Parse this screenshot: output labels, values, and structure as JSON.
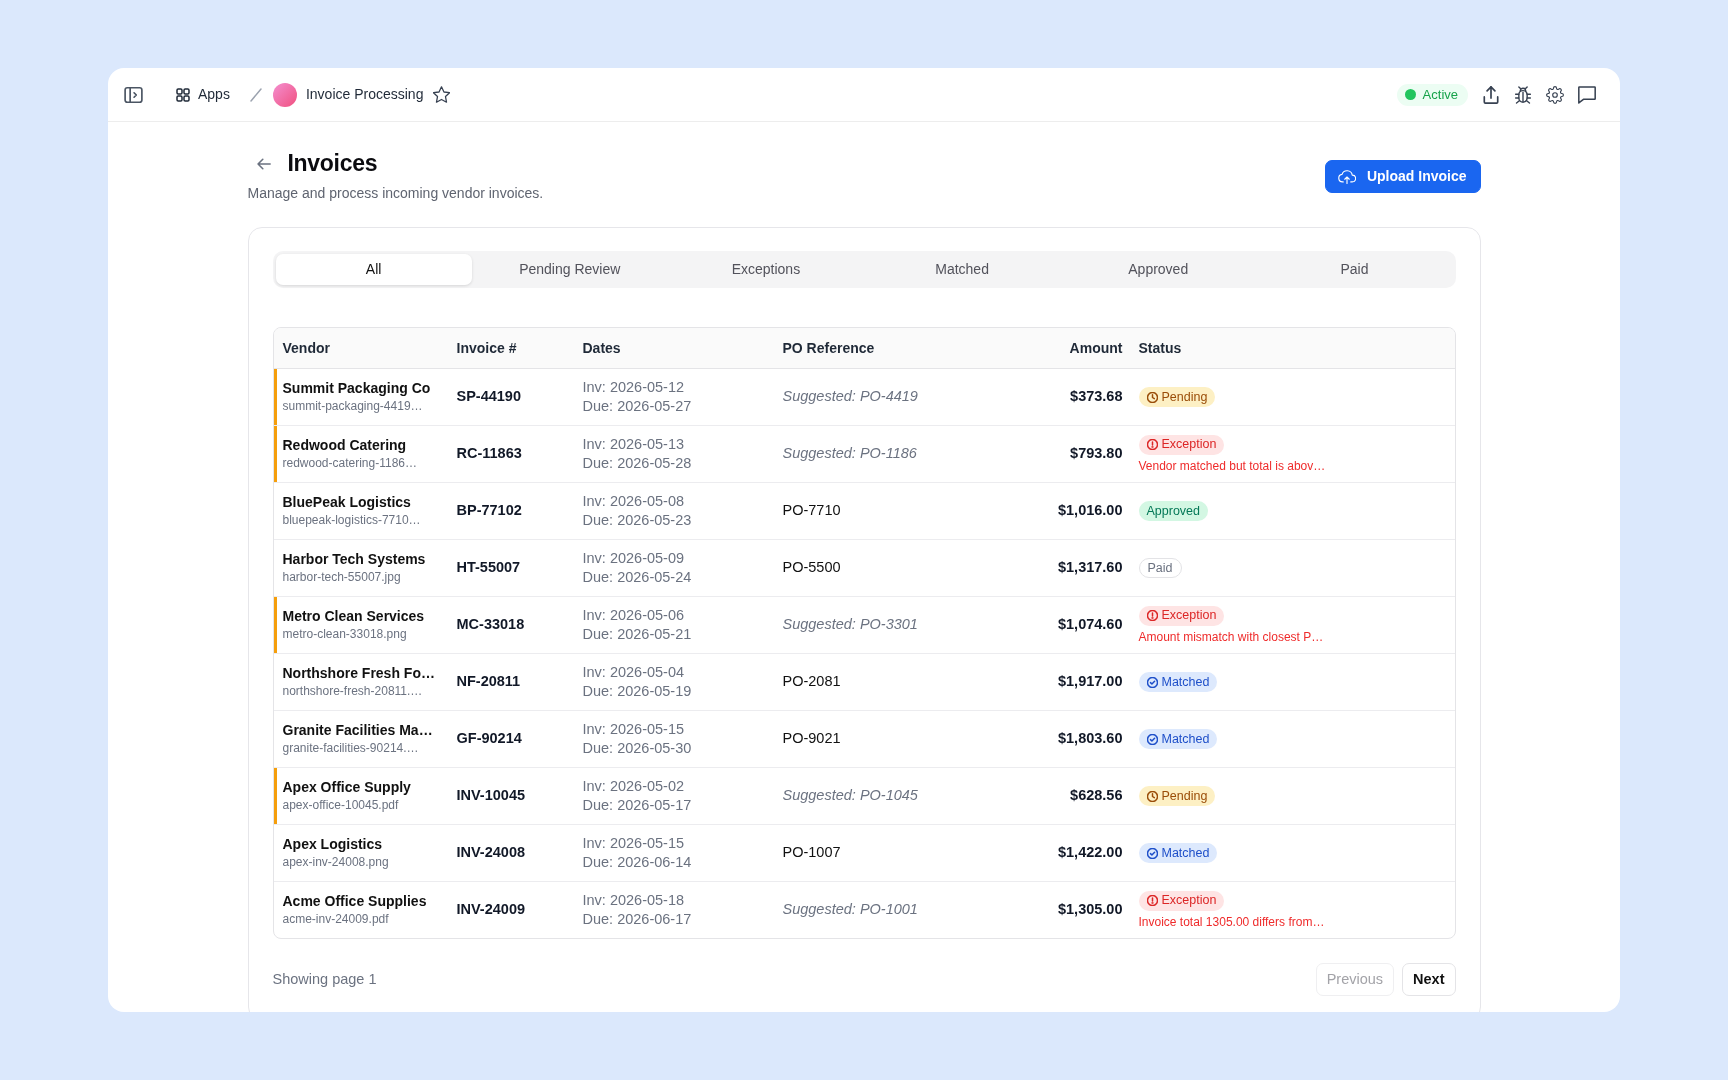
{
  "topbar": {
    "apps_label": "Apps",
    "app_name": "Invoice Processing",
    "starred": false,
    "status_label": "Active"
  },
  "header": {
    "title": "Invoices",
    "subtitle": "Manage and process incoming vendor invoices.",
    "upload_button": "Upload Invoice"
  },
  "tabs": [
    {
      "label": "All",
      "selected": true
    },
    {
      "label": "Pending Review",
      "selected": false
    },
    {
      "label": "Exceptions",
      "selected": false
    },
    {
      "label": "Matched",
      "selected": false
    },
    {
      "label": "Approved",
      "selected": false
    },
    {
      "label": "Paid",
      "selected": false
    }
  ],
  "table": {
    "columns": [
      "Vendor",
      "Invoice #",
      "Dates",
      "PO Reference",
      "Amount",
      "Status"
    ],
    "rows": [
      {
        "vendor": "Summit Packaging Co",
        "file": "summit-packaging-4419…",
        "invoice": "SP-44190",
        "invoice_date": "Inv: 2026-05-12",
        "due_date": "Due: 2026-05-27",
        "po_reference": "Suggested: PO-4419",
        "po_suggested": true,
        "amount": "$373.68",
        "status": {
          "kind": "pending",
          "label": "Pending"
        },
        "flagged": true
      },
      {
        "vendor": "Redwood Catering",
        "file": "redwood-catering-1186…",
        "invoice": "RC-11863",
        "invoice_date": "Inv: 2026-05-13",
        "due_date": "Due: 2026-05-28",
        "po_reference": "Suggested: PO-1186",
        "po_suggested": true,
        "amount": "$793.80",
        "status": {
          "kind": "exception",
          "label": "Exception",
          "note": "Vendor matched but total is abov…"
        },
        "flagged": true
      },
      {
        "vendor": "BluePeak Logistics",
        "file": "bluepeak-logistics-7710…",
        "invoice": "BP-77102",
        "invoice_date": "Inv: 2026-05-08",
        "due_date": "Due: 2026-05-23",
        "po_reference": "PO-7710",
        "po_suggested": false,
        "amount": "$1,016.00",
        "status": {
          "kind": "approved",
          "label": "Approved"
        },
        "flagged": false
      },
      {
        "vendor": "Harbor Tech Systems",
        "file": "harbor-tech-55007.jpg",
        "invoice": "HT-55007",
        "invoice_date": "Inv: 2026-05-09",
        "due_date": "Due: 2026-05-24",
        "po_reference": "PO-5500",
        "po_suggested": false,
        "amount": "$1,317.60",
        "status": {
          "kind": "paid",
          "label": "Paid"
        },
        "flagged": false
      },
      {
        "vendor": "Metro Clean Services",
        "file": "metro-clean-33018.png",
        "invoice": "MC-33018",
        "invoice_date": "Inv: 2026-05-06",
        "due_date": "Due: 2026-05-21",
        "po_reference": "Suggested: PO-3301",
        "po_suggested": true,
        "amount": "$1,074.60",
        "status": {
          "kind": "exception",
          "label": "Exception",
          "note": "Amount mismatch with closest P…"
        },
        "flagged": true
      },
      {
        "vendor": "Northshore Fresh Fo…",
        "file": "northshore-fresh-20811.…",
        "invoice": "NF-20811",
        "invoice_date": "Inv: 2026-05-04",
        "due_date": "Due: 2026-05-19",
        "po_reference": "PO-2081",
        "po_suggested": false,
        "amount": "$1,917.00",
        "status": {
          "kind": "matched",
          "label": "Matched"
        },
        "flagged": false
      },
      {
        "vendor": "Granite Facilities Ma…",
        "file": "granite-facilities-90214.…",
        "invoice": "GF-90214",
        "invoice_date": "Inv: 2026-05-15",
        "due_date": "Due: 2026-05-30",
        "po_reference": "PO-9021",
        "po_suggested": false,
        "amount": "$1,803.60",
        "status": {
          "kind": "matched",
          "label": "Matched"
        },
        "flagged": false
      },
      {
        "vendor": "Apex Office Supply",
        "file": "apex-office-10045.pdf",
        "invoice": "INV-10045",
        "invoice_date": "Inv: 2026-05-02",
        "due_date": "Due: 2026-05-17",
        "po_reference": "Suggested: PO-1045",
        "po_suggested": true,
        "amount": "$628.56",
        "status": {
          "kind": "pending",
          "label": "Pending"
        },
        "flagged": true
      },
      {
        "vendor": "Apex Logistics",
        "file": "apex-inv-24008.png",
        "invoice": "INV-24008",
        "invoice_date": "Inv: 2026-05-15",
        "due_date": "Due: 2026-06-14",
        "po_reference": "PO-1007",
        "po_suggested": false,
        "amount": "$1,422.00",
        "status": {
          "kind": "matched",
          "label": "Matched"
        },
        "flagged": false
      },
      {
        "vendor": "Acme Office Supplies",
        "file": "acme-inv-24009.pdf",
        "invoice": "INV-24009",
        "invoice_date": "Inv: 2026-05-18",
        "due_date": "Due: 2026-06-17",
        "po_reference": "Suggested: PO-1001",
        "po_suggested": true,
        "amount": "$1,305.00",
        "status": {
          "kind": "exception",
          "label": "Exception",
          "note": "Invoice total 1305.00 differs from…"
        },
        "flagged": false
      }
    ]
  },
  "pagination": {
    "summary": "Showing page 1",
    "buttons": [
      {
        "label": "Previous",
        "disabled": true
      },
      {
        "label": "Next",
        "disabled": false
      }
    ]
  }
}
